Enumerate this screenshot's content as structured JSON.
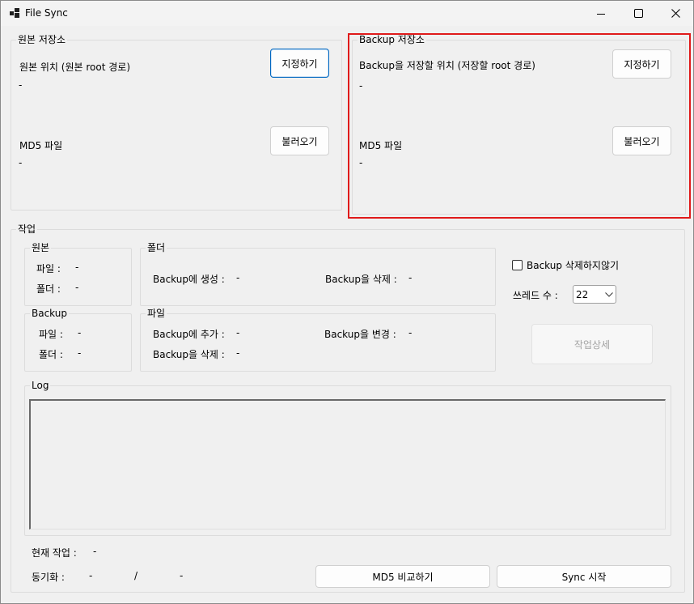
{
  "window": {
    "title": "File Sync"
  },
  "source": {
    "group_title": "원본 저장소",
    "location_label": "원본 위치 (원본 root 경로)",
    "location_value": "-",
    "set_button": "지정하기",
    "md5_label": "MD5 파일",
    "md5_value": "-",
    "load_button": "불러오기"
  },
  "backup": {
    "group_title": "Backup 저장소",
    "location_label": "Backup을 저장할 위치 (저장할 root 경로)",
    "location_value": "-",
    "set_button": "지정하기",
    "md5_label": "MD5 파일",
    "md5_value": "-",
    "load_button": "불러오기"
  },
  "task": {
    "group_title": "작업",
    "source_stats": {
      "title": "원본",
      "files_label": "파일 :",
      "files_value": "-",
      "folders_label": "폴더 :",
      "folders_value": "-"
    },
    "backup_stats": {
      "title": "Backup",
      "files_label": "파일 :",
      "files_value": "-",
      "folders_label": "폴더 :",
      "folders_value": "-"
    },
    "folder_ops": {
      "title": "폴더",
      "create_label": "Backup에 생성 :",
      "create_value": "-",
      "delete_label": "Backup을 삭제 :",
      "delete_value": "-"
    },
    "file_ops": {
      "title": "파일",
      "add_label": "Backup에 추가 :",
      "add_value": "-",
      "change_label": "Backup을 변경 :",
      "change_value": "-",
      "delete_label": "Backup을 삭제 :",
      "delete_value": "-"
    },
    "no_delete_label": "Backup 삭제하지않기",
    "no_delete_checked": false,
    "threads_label": "쓰레드 수 :",
    "threads_value": "22",
    "detail_button": "작업상세",
    "log_title": "Log",
    "log_text": "",
    "current_task_label": "현재 작업 :",
    "current_task_value": "-",
    "sync_label": "동기화 :",
    "sync_done": "-",
    "sync_separator": "/",
    "sync_total": "-",
    "md5_compare_button": "MD5 비교하기",
    "sync_start_button": "Sync 시작"
  }
}
